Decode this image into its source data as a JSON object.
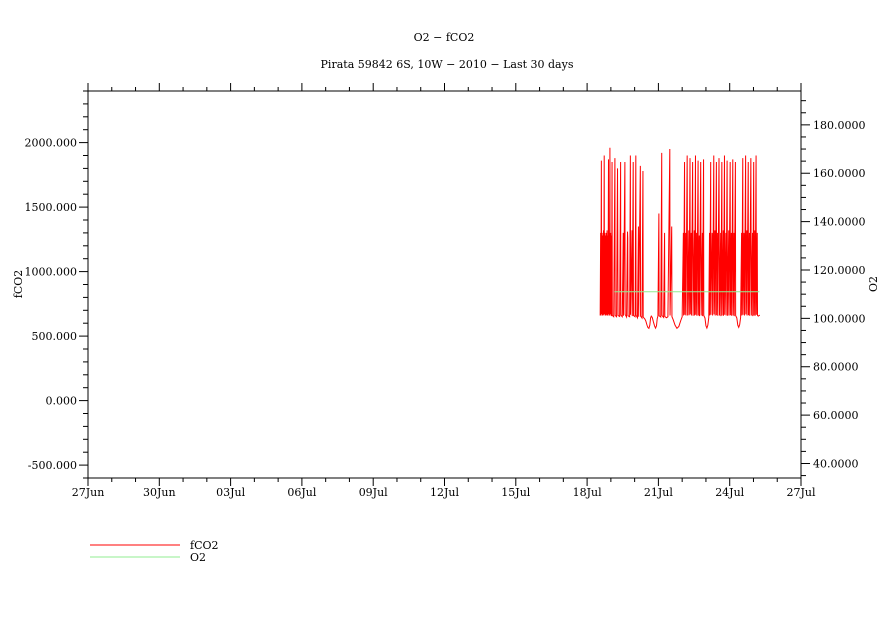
{
  "header": {
    "title": "O2 − fCO2",
    "subtitle": "Pirata 59842 6S, 10W − 2010 − Last 30 days"
  },
  "colors": {
    "fco2": "#ff0000",
    "o2": "#90ee90",
    "axis": "#000000"
  },
  "legend": [
    {
      "label": "fCO2",
      "color": "#ff0000"
    },
    {
      "label": "O2",
      "color": "#90ee90"
    }
  ],
  "chart_data": {
    "type": "line",
    "title": "O2 − fCO2",
    "subtitle": "Pirata 59842 6S, 10W − 2010 − Last 30 days",
    "grid": false,
    "legend_position": "bottom-left",
    "axes": {
      "x": {
        "unit": "date",
        "range_days": [
          0,
          30
        ],
        "major_step_days": 3,
        "minor_step_days": 1,
        "tick_labels": [
          "27Jun",
          "30Jun",
          "03Jul",
          "06Jul",
          "09Jul",
          "12Jul",
          "15Jul",
          "18Jul",
          "21Jul",
          "24Jul",
          "27Jul"
        ]
      },
      "y_left": {
        "label": "fCO2",
        "range": [
          -600,
          2400
        ],
        "major_step": 500,
        "minor_step": 100,
        "ticks": [
          {
            "v": 2000,
            "label": "2000.000"
          },
          {
            "v": 1500,
            "label": "1500.000"
          },
          {
            "v": 1000,
            "label": "1000.000"
          },
          {
            "v": 500,
            "label": "500.000"
          },
          {
            "v": 0,
            "label": "0.000"
          },
          {
            "v": -500,
            "label": "-500.000"
          }
        ]
      },
      "y_right": {
        "label": "O2",
        "range": [
          34,
          194
        ],
        "major_step": 20,
        "minor_step": 5,
        "ticks": [
          {
            "v": 180,
            "label": "180.0000"
          },
          {
            "v": 160,
            "label": "160.0000"
          },
          {
            "v": 140,
            "label": "140.0000"
          },
          {
            "v": 120,
            "label": "120.0000"
          },
          {
            "v": 100,
            "label": "100.0000"
          },
          {
            "v": 80,
            "label": "80.0000"
          },
          {
            "v": 60,
            "label": "60.0000"
          },
          {
            "v": 40,
            "label": "40.0000"
          }
        ]
      }
    },
    "series": [
      {
        "name": "fCO2",
        "axis": "left",
        "color": "#ff0000",
        "points": [
          [
            21.55,
            660
          ],
          [
            21.57,
            1300
          ],
          [
            21.58,
            660
          ],
          [
            21.6,
            1860
          ],
          [
            21.61,
            670
          ],
          [
            21.63,
            1300
          ],
          [
            21.64,
            660
          ],
          [
            21.66,
            1280
          ],
          [
            21.67,
            660
          ],
          [
            21.69,
            1320
          ],
          [
            21.7,
            665
          ],
          [
            21.72,
            1900
          ],
          [
            21.73,
            670
          ],
          [
            21.75,
            1300
          ],
          [
            21.76,
            660
          ],
          [
            21.78,
            1280
          ],
          [
            21.79,
            660
          ],
          [
            21.81,
            1300
          ],
          [
            21.82,
            665
          ],
          [
            21.84,
            1320
          ],
          [
            21.85,
            660
          ],
          [
            21.87,
            1280
          ],
          [
            21.88,
            660
          ],
          [
            21.9,
            1870
          ],
          [
            21.91,
            670
          ],
          [
            21.93,
            1300
          ],
          [
            21.94,
            660
          ],
          [
            21.96,
            1960
          ],
          [
            21.97,
            670
          ],
          [
            21.99,
            1300
          ],
          [
            22.0,
            660
          ],
          [
            22.02,
            1280
          ],
          [
            22.03,
            655
          ],
          [
            22.05,
            1850
          ],
          [
            22.06,
            660
          ],
          [
            22.12,
            650
          ],
          [
            22.17,
            1880
          ],
          [
            22.18,
            660
          ],
          [
            22.24,
            650
          ],
          [
            22.28,
            1800
          ],
          [
            22.29,
            1310
          ],
          [
            22.3,
            660
          ],
          [
            22.37,
            652
          ],
          [
            22.41,
            1850
          ],
          [
            22.42,
            662
          ],
          [
            22.48,
            650
          ],
          [
            22.52,
            1300
          ],
          [
            22.53,
            658
          ],
          [
            22.59,
            1850
          ],
          [
            22.6,
            668
          ],
          [
            22.66,
            648
          ],
          [
            22.7,
            1310
          ],
          [
            22.71,
            1260
          ],
          [
            22.72,
            658
          ],
          [
            22.79,
            650
          ],
          [
            22.82,
            1900
          ],
          [
            22.83,
            665
          ],
          [
            22.89,
            1320
          ],
          [
            22.9,
            655
          ],
          [
            22.94,
            1850
          ],
          [
            22.95,
            660
          ],
          [
            23.02,
            650
          ],
          [
            23.05,
            1900
          ],
          [
            23.06,
            662
          ],
          [
            23.12,
            642
          ],
          [
            23.16,
            1350
          ],
          [
            23.17,
            650
          ],
          [
            23.24,
            1820
          ],
          [
            23.25,
            655
          ],
          [
            23.31,
            640
          ],
          [
            23.35,
            1780
          ],
          [
            23.36,
            648
          ],
          [
            23.43,
            632
          ],
          [
            23.47,
            618
          ],
          [
            23.52,
            585
          ],
          [
            23.56,
            566
          ],
          [
            23.6,
            560
          ],
          [
            23.64,
            586
          ],
          [
            23.67,
            640
          ],
          [
            23.7,
            655
          ],
          [
            23.74,
            645
          ],
          [
            23.79,
            610
          ],
          [
            23.84,
            578
          ],
          [
            23.88,
            562
          ],
          [
            23.92,
            580
          ],
          [
            23.95,
            635
          ],
          [
            23.98,
            655
          ],
          [
            24.02,
            1450
          ],
          [
            24.03,
            658
          ],
          [
            24.1,
            648
          ],
          [
            24.14,
            1920
          ],
          [
            24.15,
            660
          ],
          [
            24.22,
            645
          ],
          [
            24.26,
            1300
          ],
          [
            24.27,
            652
          ],
          [
            24.34,
            642
          ],
          [
            24.4,
            650
          ],
          [
            24.48,
            1950
          ],
          [
            24.49,
            660
          ],
          [
            24.56,
            1350
          ],
          [
            24.57,
            650
          ],
          [
            24.62,
            628
          ],
          [
            24.7,
            585
          ],
          [
            24.78,
            560
          ],
          [
            24.86,
            575
          ],
          [
            24.94,
            620
          ],
          [
            25.0,
            650
          ],
          [
            25.05,
            1300
          ],
          [
            25.06,
            660
          ],
          [
            25.1,
            1850
          ],
          [
            25.11,
            665
          ],
          [
            25.15,
            1300
          ],
          [
            25.16,
            660
          ],
          [
            25.21,
            1900
          ],
          [
            25.22,
            1250
          ],
          [
            25.23,
            660
          ],
          [
            25.28,
            1320
          ],
          [
            25.29,
            662
          ],
          [
            25.33,
            1880
          ],
          [
            25.34,
            668
          ],
          [
            25.38,
            1300
          ],
          [
            25.39,
            660
          ],
          [
            25.44,
            1850
          ],
          [
            25.45,
            1260
          ],
          [
            25.46,
            658
          ],
          [
            25.51,
            1320
          ],
          [
            25.52,
            660
          ],
          [
            25.56,
            1900
          ],
          [
            25.57,
            665
          ],
          [
            25.61,
            1300
          ],
          [
            25.62,
            658
          ],
          [
            25.67,
            1860
          ],
          [
            25.68,
            660
          ],
          [
            25.72,
            1280
          ],
          [
            25.73,
            655
          ],
          [
            25.78,
            1850
          ],
          [
            25.79,
            1250
          ],
          [
            25.8,
            660
          ],
          [
            25.85,
            1300
          ],
          [
            25.86,
            655
          ],
          [
            25.9,
            1870
          ],
          [
            25.91,
            660
          ],
          [
            25.96,
            640
          ],
          [
            26.0,
            580
          ],
          [
            26.04,
            562
          ],
          [
            26.08,
            585
          ],
          [
            26.12,
            645
          ],
          [
            26.15,
            1300
          ],
          [
            26.16,
            660
          ],
          [
            26.2,
            1850
          ],
          [
            26.21,
            665
          ],
          [
            26.26,
            1300
          ],
          [
            26.27,
            1250
          ],
          [
            26.28,
            660
          ],
          [
            26.33,
            1900
          ],
          [
            26.34,
            668
          ],
          [
            26.38,
            1320
          ],
          [
            26.39,
            660
          ],
          [
            26.44,
            1850
          ],
          [
            26.45,
            662
          ],
          [
            26.49,
            1300
          ],
          [
            26.5,
            658
          ],
          [
            26.55,
            1880
          ],
          [
            26.56,
            1260
          ],
          [
            26.57,
            660
          ],
          [
            26.62,
            1300
          ],
          [
            26.63,
            655
          ],
          [
            26.67,
            1850
          ],
          [
            26.68,
            660
          ],
          [
            26.73,
            1320
          ],
          [
            26.74,
            658
          ],
          [
            26.78,
            1900
          ],
          [
            26.79,
            665
          ],
          [
            26.84,
            1300
          ],
          [
            26.85,
            660
          ],
          [
            26.89,
            1860
          ],
          [
            26.9,
            1250
          ],
          [
            26.91,
            658
          ],
          [
            26.96,
            1320
          ],
          [
            26.97,
            660
          ],
          [
            27.02,
            1850
          ],
          [
            27.03,
            662
          ],
          [
            27.07,
            1300
          ],
          [
            27.08,
            658
          ],
          [
            27.13,
            1870
          ],
          [
            27.14,
            660
          ],
          [
            27.18,
            1300
          ],
          [
            27.19,
            655
          ],
          [
            27.24,
            1850
          ],
          [
            27.25,
            660
          ],
          [
            27.3,
            640
          ],
          [
            27.34,
            585
          ],
          [
            27.38,
            568
          ],
          [
            27.42,
            590
          ],
          [
            27.46,
            645
          ],
          [
            27.5,
            1300
          ],
          [
            27.51,
            660
          ],
          [
            27.55,
            1880
          ],
          [
            27.56,
            665
          ],
          [
            27.6,
            1300
          ],
          [
            27.61,
            1250
          ],
          [
            27.62,
            660
          ],
          [
            27.67,
            1900
          ],
          [
            27.68,
            668
          ],
          [
            27.72,
            1320
          ],
          [
            27.73,
            660
          ],
          [
            27.78,
            1850
          ],
          [
            27.79,
            662
          ],
          [
            27.83,
            1300
          ],
          [
            27.84,
            658
          ],
          [
            27.89,
            1880
          ],
          [
            27.9,
            1260
          ],
          [
            27.91,
            660
          ],
          [
            27.96,
            1300
          ],
          [
            27.97,
            655
          ],
          [
            28.01,
            1850
          ],
          [
            28.02,
            660
          ],
          [
            28.06,
            1320
          ],
          [
            28.07,
            658
          ],
          [
            28.11,
            1900
          ],
          [
            28.12,
            665
          ],
          [
            28.16,
            1300
          ],
          [
            28.17,
            660
          ],
          [
            28.2,
            655
          ],
          [
            28.24,
            660
          ],
          [
            28.27,
            662
          ]
        ]
      },
      {
        "name": "O2",
        "axis": "right",
        "color": "#90ee90",
        "points": [
          [
            22.15,
            111
          ],
          [
            28.25,
            111
          ]
        ]
      }
    ]
  }
}
